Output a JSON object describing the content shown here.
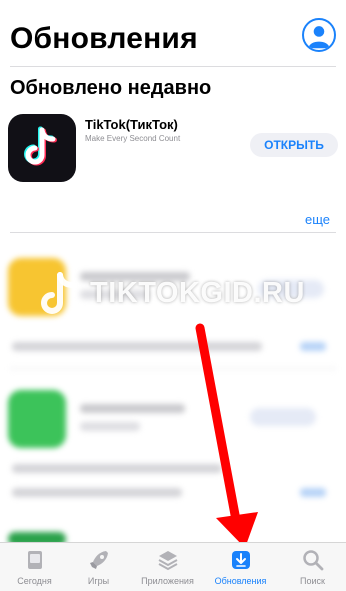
{
  "header": {
    "title": "Обновления"
  },
  "section": {
    "title": "Обновлено недавно"
  },
  "app": {
    "name": "TikTok(ТикТок)",
    "subtitle": "Make Every Second Count",
    "open_label": "ОТКРЫТЬ"
  },
  "more_label": "еще",
  "watermark": "TIKTOKGID.RU",
  "tabs": [
    {
      "label": "Сегодня",
      "icon": "today-icon",
      "active": false
    },
    {
      "label": "Игры",
      "icon": "rocket-icon",
      "active": false
    },
    {
      "label": "Приложения",
      "icon": "apps-stack-icon",
      "active": false
    },
    {
      "label": "Обновления",
      "icon": "updates-download-icon",
      "active": true
    },
    {
      "label": "Поиск",
      "icon": "search-icon",
      "active": false
    }
  ],
  "colors": {
    "accent": "#1a82fb",
    "arrow": "#ff0000",
    "tiktok_bg": "#111016"
  }
}
